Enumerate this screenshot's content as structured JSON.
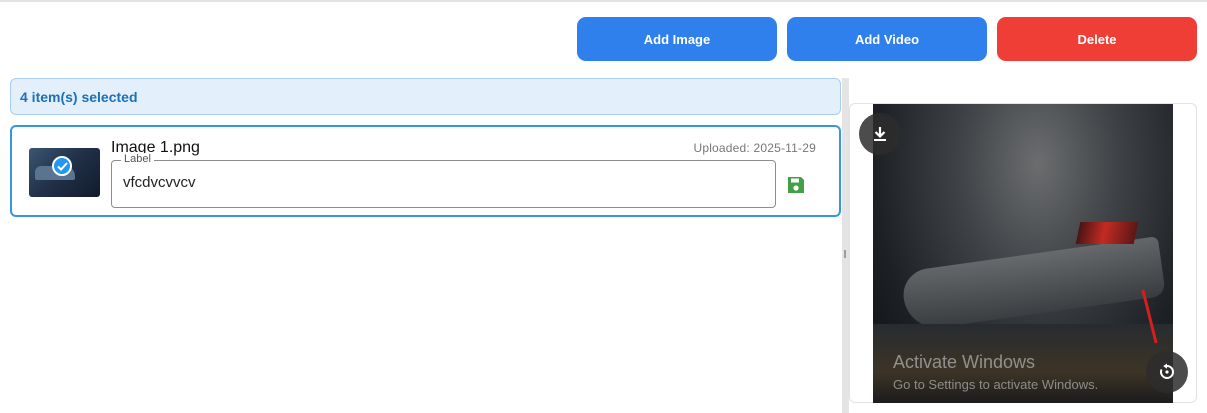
{
  "toolbar": {
    "add_image_label": "Add Image",
    "add_video_label": "Add Video",
    "delete_label": "Delete"
  },
  "selection": {
    "text": "4 item(s) selected"
  },
  "items": [
    {
      "name": "Image 1.png",
      "uploaded": "Uploaded: 2025-11-29",
      "label_caption": "Label",
      "label_value": "vfcdvcvvcv",
      "icons": {
        "selected": "check-circle-icon",
        "save": "floppy-disk-icon"
      }
    }
  ],
  "preview": {
    "watermark_title": "Activate Windows",
    "watermark_sub": "Go to Settings to activate Windows.",
    "icons": {
      "download": "download-icon",
      "rotate": "rotate-icon"
    }
  },
  "colors": {
    "primary": "#2f80ed",
    "danger": "#ef3e36",
    "selected_border": "#3796dc",
    "banner_bg": "#e3f0fc",
    "banner_text": "#1d6fb8",
    "save_icon": "#43a047"
  }
}
